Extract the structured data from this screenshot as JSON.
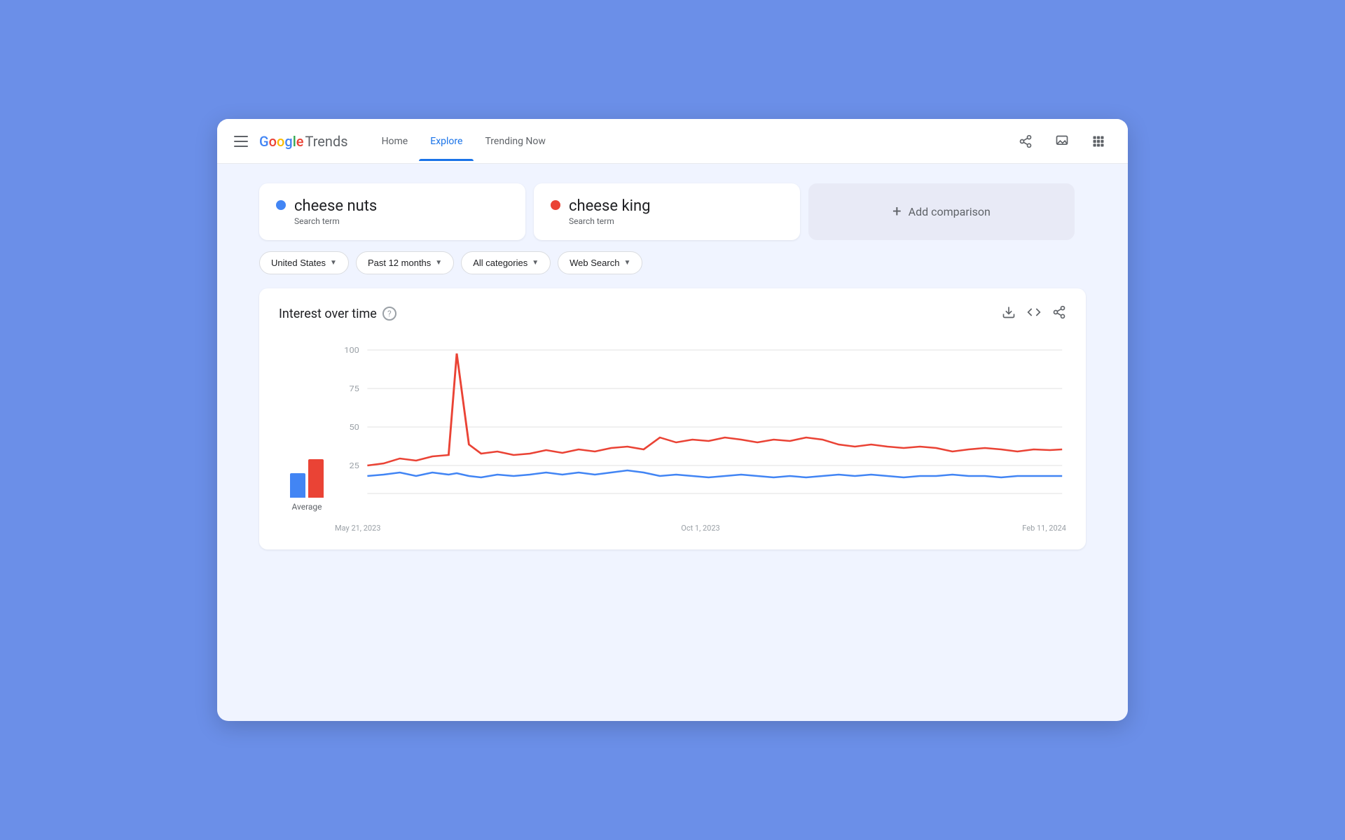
{
  "header": {
    "logo_google": "Google",
    "logo_trends": "Trends",
    "nav": [
      {
        "id": "home",
        "label": "Home",
        "active": false
      },
      {
        "id": "explore",
        "label": "Explore",
        "active": true
      },
      {
        "id": "trending",
        "label": "Trending Now",
        "active": false
      }
    ]
  },
  "search_terms": [
    {
      "id": "term1",
      "term": "cheese nuts",
      "type": "Search term",
      "dot_color": "blue"
    },
    {
      "id": "term2",
      "term": "cheese king",
      "type": "Search term",
      "dot_color": "red"
    }
  ],
  "add_comparison": {
    "label": "Add comparison"
  },
  "filters": [
    {
      "id": "region",
      "label": "United States"
    },
    {
      "id": "time",
      "label": "Past 12 months"
    },
    {
      "id": "category",
      "label": "All categories"
    },
    {
      "id": "search_type",
      "label": "Web Search"
    }
  ],
  "chart": {
    "title": "Interest over time",
    "help": "?",
    "x_labels": [
      "May 21, 2023",
      "Oct 1, 2023",
      "Feb 11, 2024"
    ],
    "y_labels": [
      "100",
      "75",
      "50",
      "25"
    ],
    "avg_label": "Average"
  }
}
